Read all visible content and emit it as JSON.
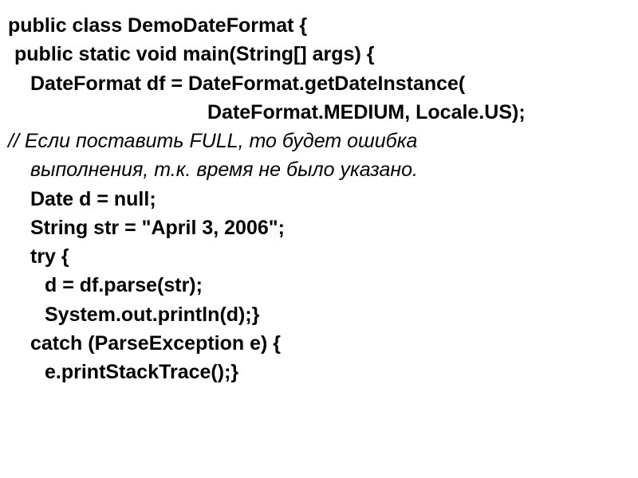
{
  "code": {
    "l1": "public class DemoDateFormat {",
    "l2": "public static void main(String[] args) {",
    "l3": "DateFormat df = DateFormat.getDateInstance(",
    "l4": "DateFormat.MEDIUM, Locale.US);",
    "l5": "// Если поставить FULL, то будет ошибка",
    "l6": "выполнения, т.к. время не было указано.",
    "l7": "Date d = null;",
    "l8": "String str = \"April 3, 2006\";",
    "l9": "try {",
    "l10": "d = df.parse(str);",
    "l11": "System.out.println(d);}",
    "l12": "catch (ParseException e) {",
    "l13": "e.printStackTrace();}"
  }
}
